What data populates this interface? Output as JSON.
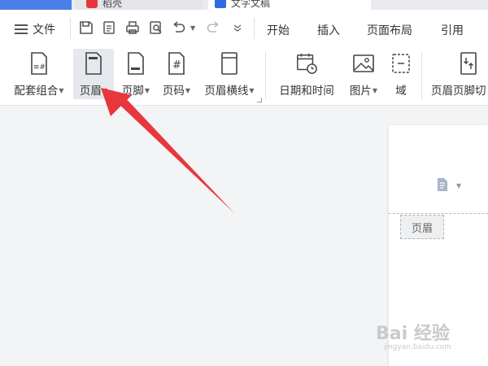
{
  "tabs": {
    "tab2_title": "稻壳",
    "tab3_title": "文字文稿"
  },
  "menu": {
    "file_label": "文件",
    "tabs": [
      "开始",
      "插入",
      "页面布局",
      "引用"
    ]
  },
  "ribbon": {
    "buttons": [
      {
        "label": "配套组合",
        "icon": "suite-icon",
        "dropdown": true
      },
      {
        "label": "页眉",
        "icon": "header-icon",
        "dropdown": true,
        "active": true
      },
      {
        "label": "页脚",
        "icon": "footer-icon",
        "dropdown": true
      },
      {
        "label": "页码",
        "icon": "page-number-icon",
        "dropdown": true
      },
      {
        "label": "页眉横线",
        "icon": "header-line-icon",
        "dropdown": true
      },
      {
        "label": "日期和时间",
        "icon": "calendar-clock-icon",
        "dropdown": false
      },
      {
        "label": "图片",
        "icon": "image-icon",
        "dropdown": true
      },
      {
        "label": "域",
        "icon": "field-icon",
        "dropdown": false
      },
      {
        "label": "页眉页脚切",
        "icon": "header-footer-switch-icon",
        "dropdown": false
      }
    ]
  },
  "document": {
    "header_tag": "页眉"
  },
  "watermark": {
    "main": "Bai 经验",
    "sub": "jingyan.baidu.com"
  },
  "colors": {
    "accent_blue": "#4a7ee8",
    "arrow_red": "#e8363d",
    "active_bg": "#e5e8ed"
  }
}
